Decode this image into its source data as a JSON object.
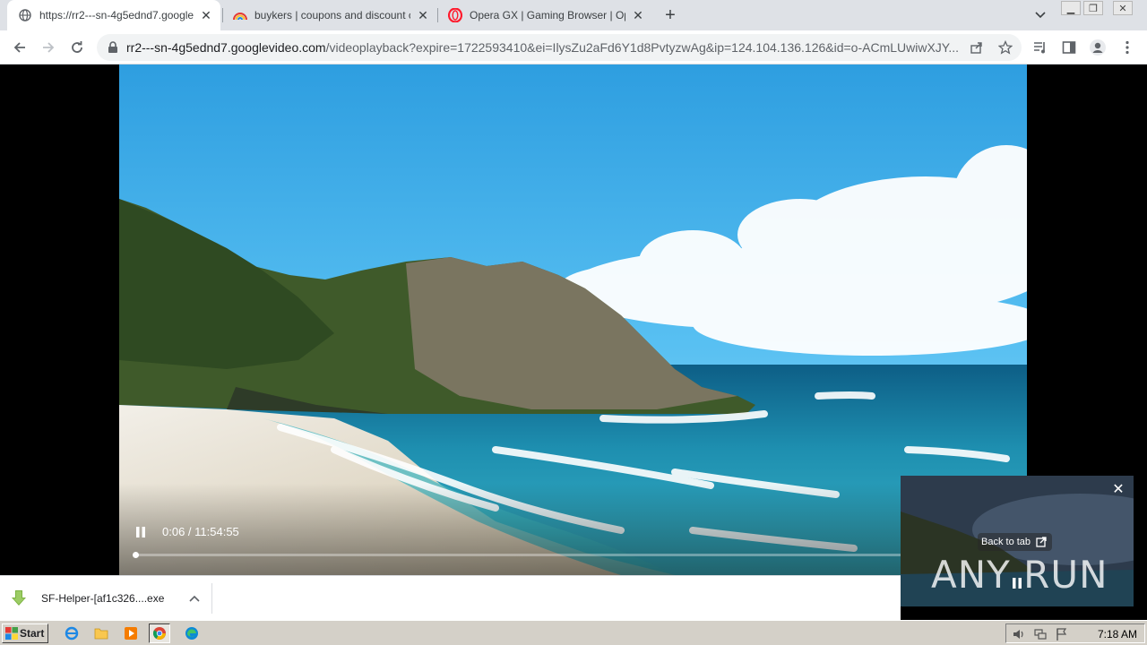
{
  "tabs": [
    {
      "title": "https://rr2---sn-4g5ednd7.googlevideo.com/videoplayback?expire=1722593410",
      "active": true
    },
    {
      "title": "buykers | coupons and discount codes",
      "active": false
    },
    {
      "title": "Opera GX | Gaming Browser | Opera",
      "active": false
    }
  ],
  "address_bar": {
    "host": "rr2---sn-4g5ednd7.googlevideo.com",
    "path": "/videoplayback?expire=1722593410&ei=IlysZu2aFd6Y1d8PvtyzwAg&ip=124.104.136.126&id=o-ACmLUwiwXJY..."
  },
  "video": {
    "time": "0:06 / 11:54:55",
    "progress_fraction": 0.002
  },
  "pip": {
    "back_label": "Back to tab",
    "watermark": "ANY RUN"
  },
  "download": {
    "filename": "SF-Helper-[af1c326....exe"
  },
  "taskbar": {
    "start_label": "Start",
    "clock": "7:18 AM"
  },
  "colors": {
    "tabstrip": "#dee1e6",
    "sky": "#3aa9e6",
    "sea": "#1e8aa6",
    "taskbar": "#d4d0c8"
  }
}
